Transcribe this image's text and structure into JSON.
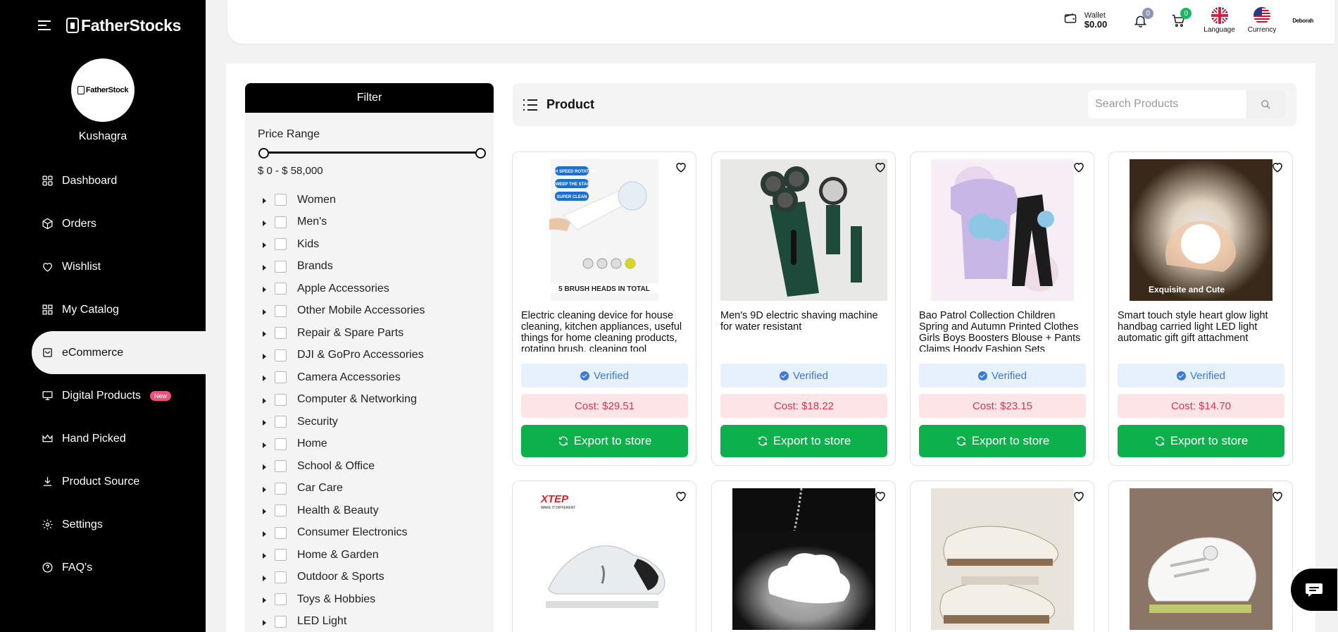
{
  "brand": {
    "name": "FatherStocks",
    "avatar_text": "FatherStock"
  },
  "user": {
    "name": "Kushagra",
    "short": "Deborah"
  },
  "nav": [
    {
      "label": "Dashboard",
      "icon": "dashboard-icon"
    },
    {
      "label": "Orders",
      "icon": "box-icon"
    },
    {
      "label": "Wishlist",
      "icon": "heart-icon"
    },
    {
      "label": "My Catalog",
      "icon": "grid-icon"
    },
    {
      "label": "eCommerce",
      "icon": "store-icon",
      "active": true
    },
    {
      "label": "Digital Products",
      "icon": "monitor-icon",
      "badge": "New"
    },
    {
      "label": "Hand Picked",
      "icon": "crown-icon"
    },
    {
      "label": "Product Source",
      "icon": "download-icon"
    },
    {
      "label": "Settings",
      "icon": "gear-icon"
    },
    {
      "label": "FAQ's",
      "icon": "help-icon"
    }
  ],
  "header": {
    "wallet_label": "Wallet",
    "wallet_value": "$0.00",
    "notification_count": "0",
    "cart_count": "0",
    "language_label": "Language",
    "currency_label": "Currency"
  },
  "filter": {
    "title": "Filter",
    "price_label": "Price Range",
    "price_value": "$ 0 - $ 58,000",
    "categories": [
      "Women",
      "Men's",
      "Kids",
      "Brands",
      "Apple Accessories",
      "Other Mobile Accessories",
      "Repair & Spare Parts",
      "DJI & GoPro Accessories",
      "Camera Accessories",
      "Computer & Networking",
      "Security",
      "Home",
      "School & Office",
      "Car Care",
      "Health & Beauty",
      "Consumer Electronics",
      "Home & Garden",
      "Outdoor & Sports",
      "Toys & Hobbies",
      "LED Light"
    ]
  },
  "products_header": {
    "title": "Product",
    "search_placeholder": "Search Products"
  },
  "labels": {
    "verified": "Verified",
    "export": "Export to store"
  },
  "products": [
    {
      "title": "Electric cleaning device for house cleaning, kitchen appliances, useful things for home cleaning products, rotating brush, cleaning tool",
      "cost": "Cost: $29.51",
      "img_text": [
        "HIGH SPEED ROTATION",
        "SWEEP THE STAIN",
        "SUPER CLEAN",
        "5 BRUSH HEADS IN TOTAL"
      ]
    },
    {
      "title": "Men's 9D electric shaving machine for water resistant",
      "cost": "Cost: $18.22"
    },
    {
      "title": "Bao Patrol Collection Children Spring and Autumn Printed Clothes Girls Boys Boosters Blouse + Pants Claims Hoody Fashion Sets",
      "cost": "Cost: $23.15"
    },
    {
      "title": "Smart touch style heart glow light handbag carried light LED light automatic gift gift attachment",
      "cost": "Cost: $14.70",
      "img_text": [
        "Exquisite and Cute"
      ]
    },
    {
      "title": "",
      "cost": "",
      "img_text": [
        "XTEP",
        "MAKE IT DIFFERENT"
      ]
    },
    {
      "title": "",
      "cost": ""
    },
    {
      "title": "",
      "cost": ""
    },
    {
      "title": "",
      "cost": ""
    }
  ]
}
